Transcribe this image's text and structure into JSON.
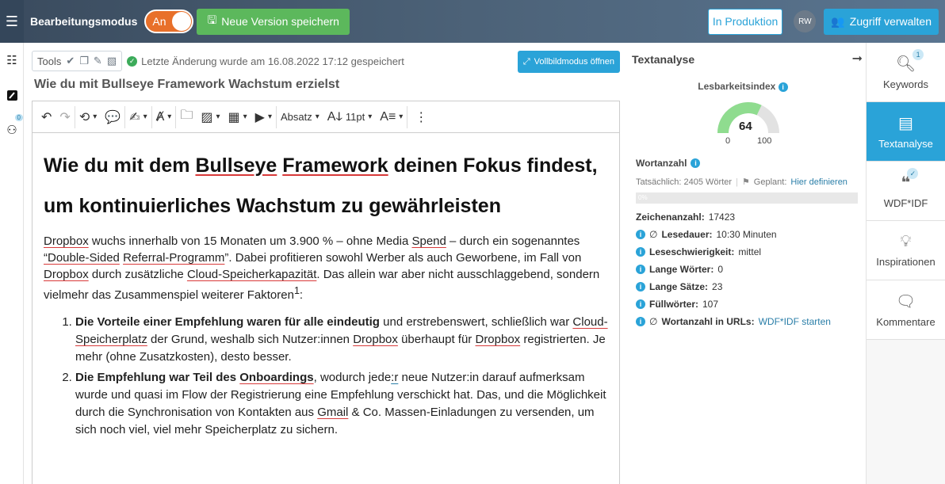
{
  "header": {
    "menu_icon": "hamburger-icon",
    "mode_label": "Bearbeitungsmodus",
    "toggle_label": "An",
    "save_version_label": "Neue Version speichern",
    "production_label": "In Produktion",
    "avatar_initials": "RW",
    "access_label": "Zugriff verwalten"
  },
  "left_sidebar": {
    "items": [
      {
        "icon": "list-icon"
      },
      {
        "icon": "edit-icon"
      },
      {
        "icon": "users-icon",
        "badge": "0"
      }
    ]
  },
  "editor": {
    "tools_label": "Tools",
    "saved_text": "Letzte Änderung wurde am 16.08.2022 17:12 gespeichert",
    "fullscreen_label": "Vollbildmodus öffnen",
    "doc_title": "Wie du mit Bullseye Framework Wachstum erzielst",
    "toolbar": {
      "paragraph_label": "Absatz",
      "font_size_label": "11pt"
    },
    "content": {
      "h1_a": "Wie du mit dem ",
      "h1_b": "Bullseye",
      "h1_c": " ",
      "h1_d": "Framework",
      "h1_e": " deinen Fokus findest, um kontinuierliches Wachstum zu gewährleisten",
      "p1_a": "Dropbox",
      "p1_b": " wuchs innerhalb von 15 Monaten um 3.900 % – ohne Media ",
      "p1_c": "Spend",
      "p1_d": " – durch ein sogenanntes ",
      "p1_e": "“Double-Sided",
      "p1_f": " ",
      "p1_g": "Referral-Programm",
      "p1_h": "”. Dabei profitieren sowohl Werber als auch Geworbene, im Fall von ",
      "p1_i": "Dropbox",
      "p1_j": " durch zusätzliche ",
      "p1_k": "Cloud-Speicherkapazität",
      "p1_l": ". Das allein war aber nicht ausschlaggebend, sondern vielmehr das Zusammenspiel weiterer Faktoren",
      "p1_sup": "1",
      "p1_m": ":",
      "li1_bold": "Die Vorteile einer Empfehlung waren für alle eindeutig",
      "li1_a": " und erstrebenswert, schließlich war ",
      "li1_b": "Cloud-Speicherplatz",
      "li1_c": " der Grund, weshalb sich Nutzer:innen ",
      "li1_d": "Dropbox",
      "li1_e": " überhaupt für ",
      "li1_f": "Dropbox",
      "li1_g": " registrierten. Je mehr (ohne Zusatzkosten), desto besser.",
      "li2_bold": "Die Empfehlung war Teil des ",
      "li2_bold_u": "Onboardings",
      "li2_a": ", wodurch jede",
      "li2_b": ":r",
      "li2_c": " neue Nutzer:in darauf aufmerksam wurde und quasi im Flow der Registrierung eine Empfehlung verschickt hat. Das, und die Möglichkeit durch die Synchronisation von Kontakten aus ",
      "li2_d": "Gmail",
      "li2_e": " & Co. Massen-Einladungen zu versenden, um sich noch viel, viel mehr Speicherplatz zu sichern."
    }
  },
  "analysis": {
    "title": "Textanalyse",
    "readability_label": "Lesbarkeitsindex",
    "readability_value": "64",
    "readability_score": 64,
    "gauge_min": "0",
    "gauge_max": "100",
    "wordcount_label": "Wortanzahl",
    "actual_label": "Tatsächlich: 2405 Wörter",
    "planned_label": "Geplant:",
    "planned_link": "Hier definieren",
    "progress_text": "0%",
    "chars_label": "Zeichenanzahl:",
    "chars_value": "17423",
    "read_time_label": "Lesedauer:",
    "read_time_value": "10:30 Minuten",
    "difficulty_label": "Leseschwierigkeit:",
    "difficulty_value": "mittel",
    "long_words_label": "Lange Wörter:",
    "long_words_value": "0",
    "long_sentences_label": "Lange Sätze:",
    "long_sentences_value": "23",
    "filler_label": "Füllwörter:",
    "filler_value": "107",
    "url_words_label": "Wortanzahl in URLs:",
    "url_words_link": "WDF*IDF starten"
  },
  "right_sidebar": {
    "items": [
      {
        "label": "Keywords",
        "icon": "keywords-icon",
        "badge": "1"
      },
      {
        "label": "Textanalyse",
        "icon": "document-icon"
      },
      {
        "label": "WDF*IDF",
        "icon": "quote-icon"
      },
      {
        "label": "Inspirationen",
        "icon": "lightbulb-icon"
      },
      {
        "label": "Kommentare",
        "icon": "comments-icon"
      }
    ]
  }
}
